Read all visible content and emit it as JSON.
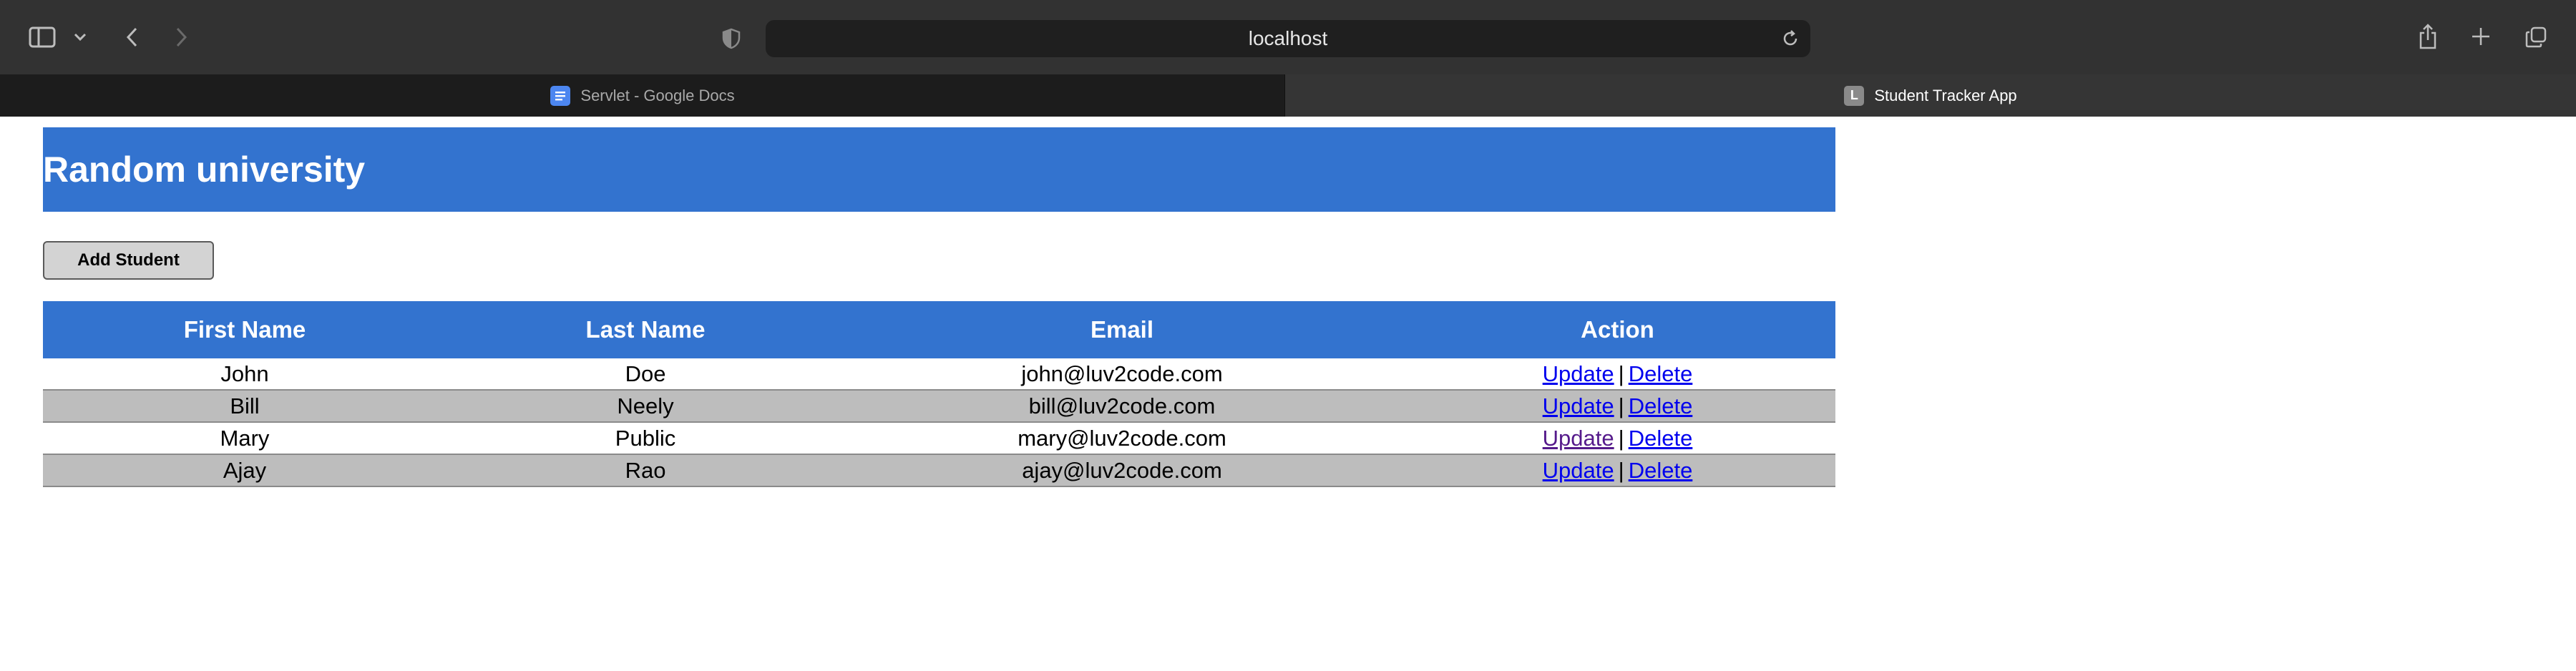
{
  "browser": {
    "url": "localhost",
    "tabs": [
      {
        "title": "Servlet - Google Docs",
        "active": false,
        "favicon": "google-docs-icon"
      },
      {
        "title": "Student Tracker App",
        "active": true,
        "favicon_letter": "L"
      }
    ]
  },
  "page": {
    "heading": "Random university",
    "add_button_label": "Add Student",
    "header_color": "#3373cf",
    "alt_row_color": "#bdbdbd"
  },
  "table": {
    "columns": [
      "First Name",
      "Last Name",
      "Email",
      "Action"
    ],
    "rows": [
      {
        "first": "John",
        "last": "Doe",
        "email": "john@luv2code.com",
        "update": "Update",
        "sep": "|",
        "delete": "Delete"
      },
      {
        "first": "Bill",
        "last": "Neely",
        "email": "bill@luv2code.com",
        "update": "Update",
        "sep": "|",
        "delete": "Delete"
      },
      {
        "first": "Mary",
        "last": "Public",
        "email": "mary@luv2code.com",
        "update": "Update",
        "sep": "|",
        "delete": "Delete"
      },
      {
        "first": "Ajay",
        "last": "Rao",
        "email": "ajay@luv2code.com",
        "update": "Update",
        "sep": "|",
        "delete": "Delete"
      }
    ]
  }
}
